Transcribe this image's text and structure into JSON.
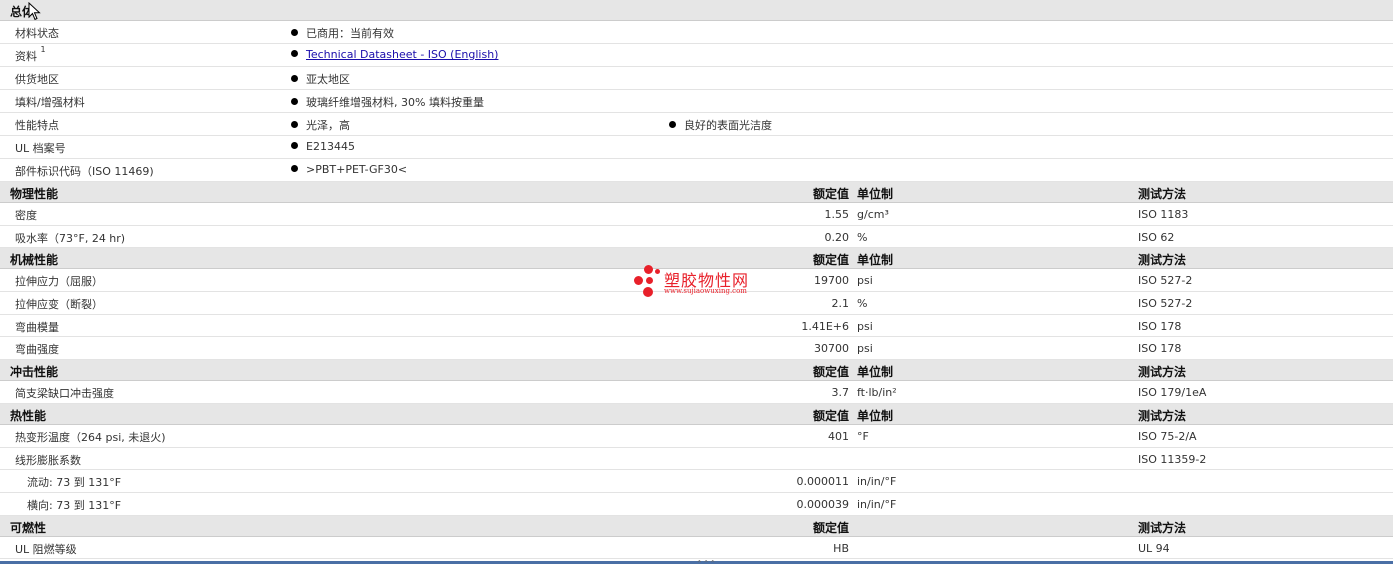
{
  "general": {
    "title": "总体",
    "rows": [
      {
        "label": "材料状态",
        "items": [
          "已商用：当前有效"
        ]
      },
      {
        "label": "资料",
        "sup": "1",
        "link": "Technical Datasheet - ISO (English)"
      },
      {
        "label": "供货地区",
        "items": [
          "亚太地区"
        ]
      },
      {
        "label": "填料/增强材料",
        "items": [
          "玻璃纤维增强材料, 30% 填料按重量"
        ]
      },
      {
        "label": "性能特点",
        "items": [
          "光泽，高",
          "良好的表面光洁度"
        ]
      },
      {
        "label": "UL 档案号",
        "items": [
          "E213445"
        ]
      },
      {
        "label": "部件标识代码（ISO 11469)",
        "items": [
          ">PBT+PET-GF30<"
        ]
      }
    ]
  },
  "headers": {
    "value": "额定值",
    "unit": "单位制",
    "test": "测试方法"
  },
  "sections": [
    {
      "title": "物理性能",
      "rows": [
        {
          "label": "密度",
          "value": "1.55",
          "unit": "g/cm³",
          "test": "ISO 1183"
        },
        {
          "label": "吸水率（73°F, 24 hr)",
          "value": "0.20",
          "unit": "%",
          "test": "ISO 62"
        }
      ]
    },
    {
      "title": "机械性能",
      "rows": [
        {
          "label": "拉伸应力（屈服）",
          "value": "19700",
          "unit": "psi",
          "test": "ISO 527-2"
        },
        {
          "label": "拉伸应变（断裂）",
          "value": "2.1",
          "unit": "%",
          "test": "ISO 527-2"
        },
        {
          "label": "弯曲模量",
          "value": "1.41E+6",
          "unit": "psi",
          "test": "ISO 178"
        },
        {
          "label": "弯曲强度",
          "value": "30700",
          "unit": "psi",
          "test": "ISO 178"
        }
      ]
    },
    {
      "title": "冲击性能",
      "rows": [
        {
          "label": "简支梁缺口冲击强度",
          "value": "3.7",
          "unit": "ft·lb/in²",
          "test": "ISO 179/1eA"
        }
      ]
    },
    {
      "title": "热性能",
      "rows": [
        {
          "label": "热变形温度（264 psi, 未退火)",
          "value": "401",
          "unit": "°F",
          "test": "ISO 75-2/A"
        },
        {
          "label": "线形膨胀系数",
          "value": "",
          "unit": "",
          "test": "ISO 11359-2"
        },
        {
          "label": "流动: 73 到 131°F",
          "value": "0.000011",
          "unit": "in/in/°F",
          "test": "",
          "sub": true
        },
        {
          "label": "横向: 73 到 131°F",
          "value": "0.000039",
          "unit": "in/in/°F",
          "test": "",
          "sub": true
        }
      ]
    },
    {
      "title": "可燃性",
      "no_unit_header": true,
      "rows": [
        {
          "label": "UL 阻燃等级",
          "value": "HB",
          "unit": "",
          "test": "UL 94"
        }
      ]
    }
  ],
  "watermark": {
    "name": "塑胶物性网",
    "url": "www.sujiaowuxing.com"
  },
  "colors": {
    "section_bg": "#e6e6e6",
    "link": "#1a0dab",
    "watermark": "#e8202a",
    "bottom_bar": "#4a6fa5"
  }
}
